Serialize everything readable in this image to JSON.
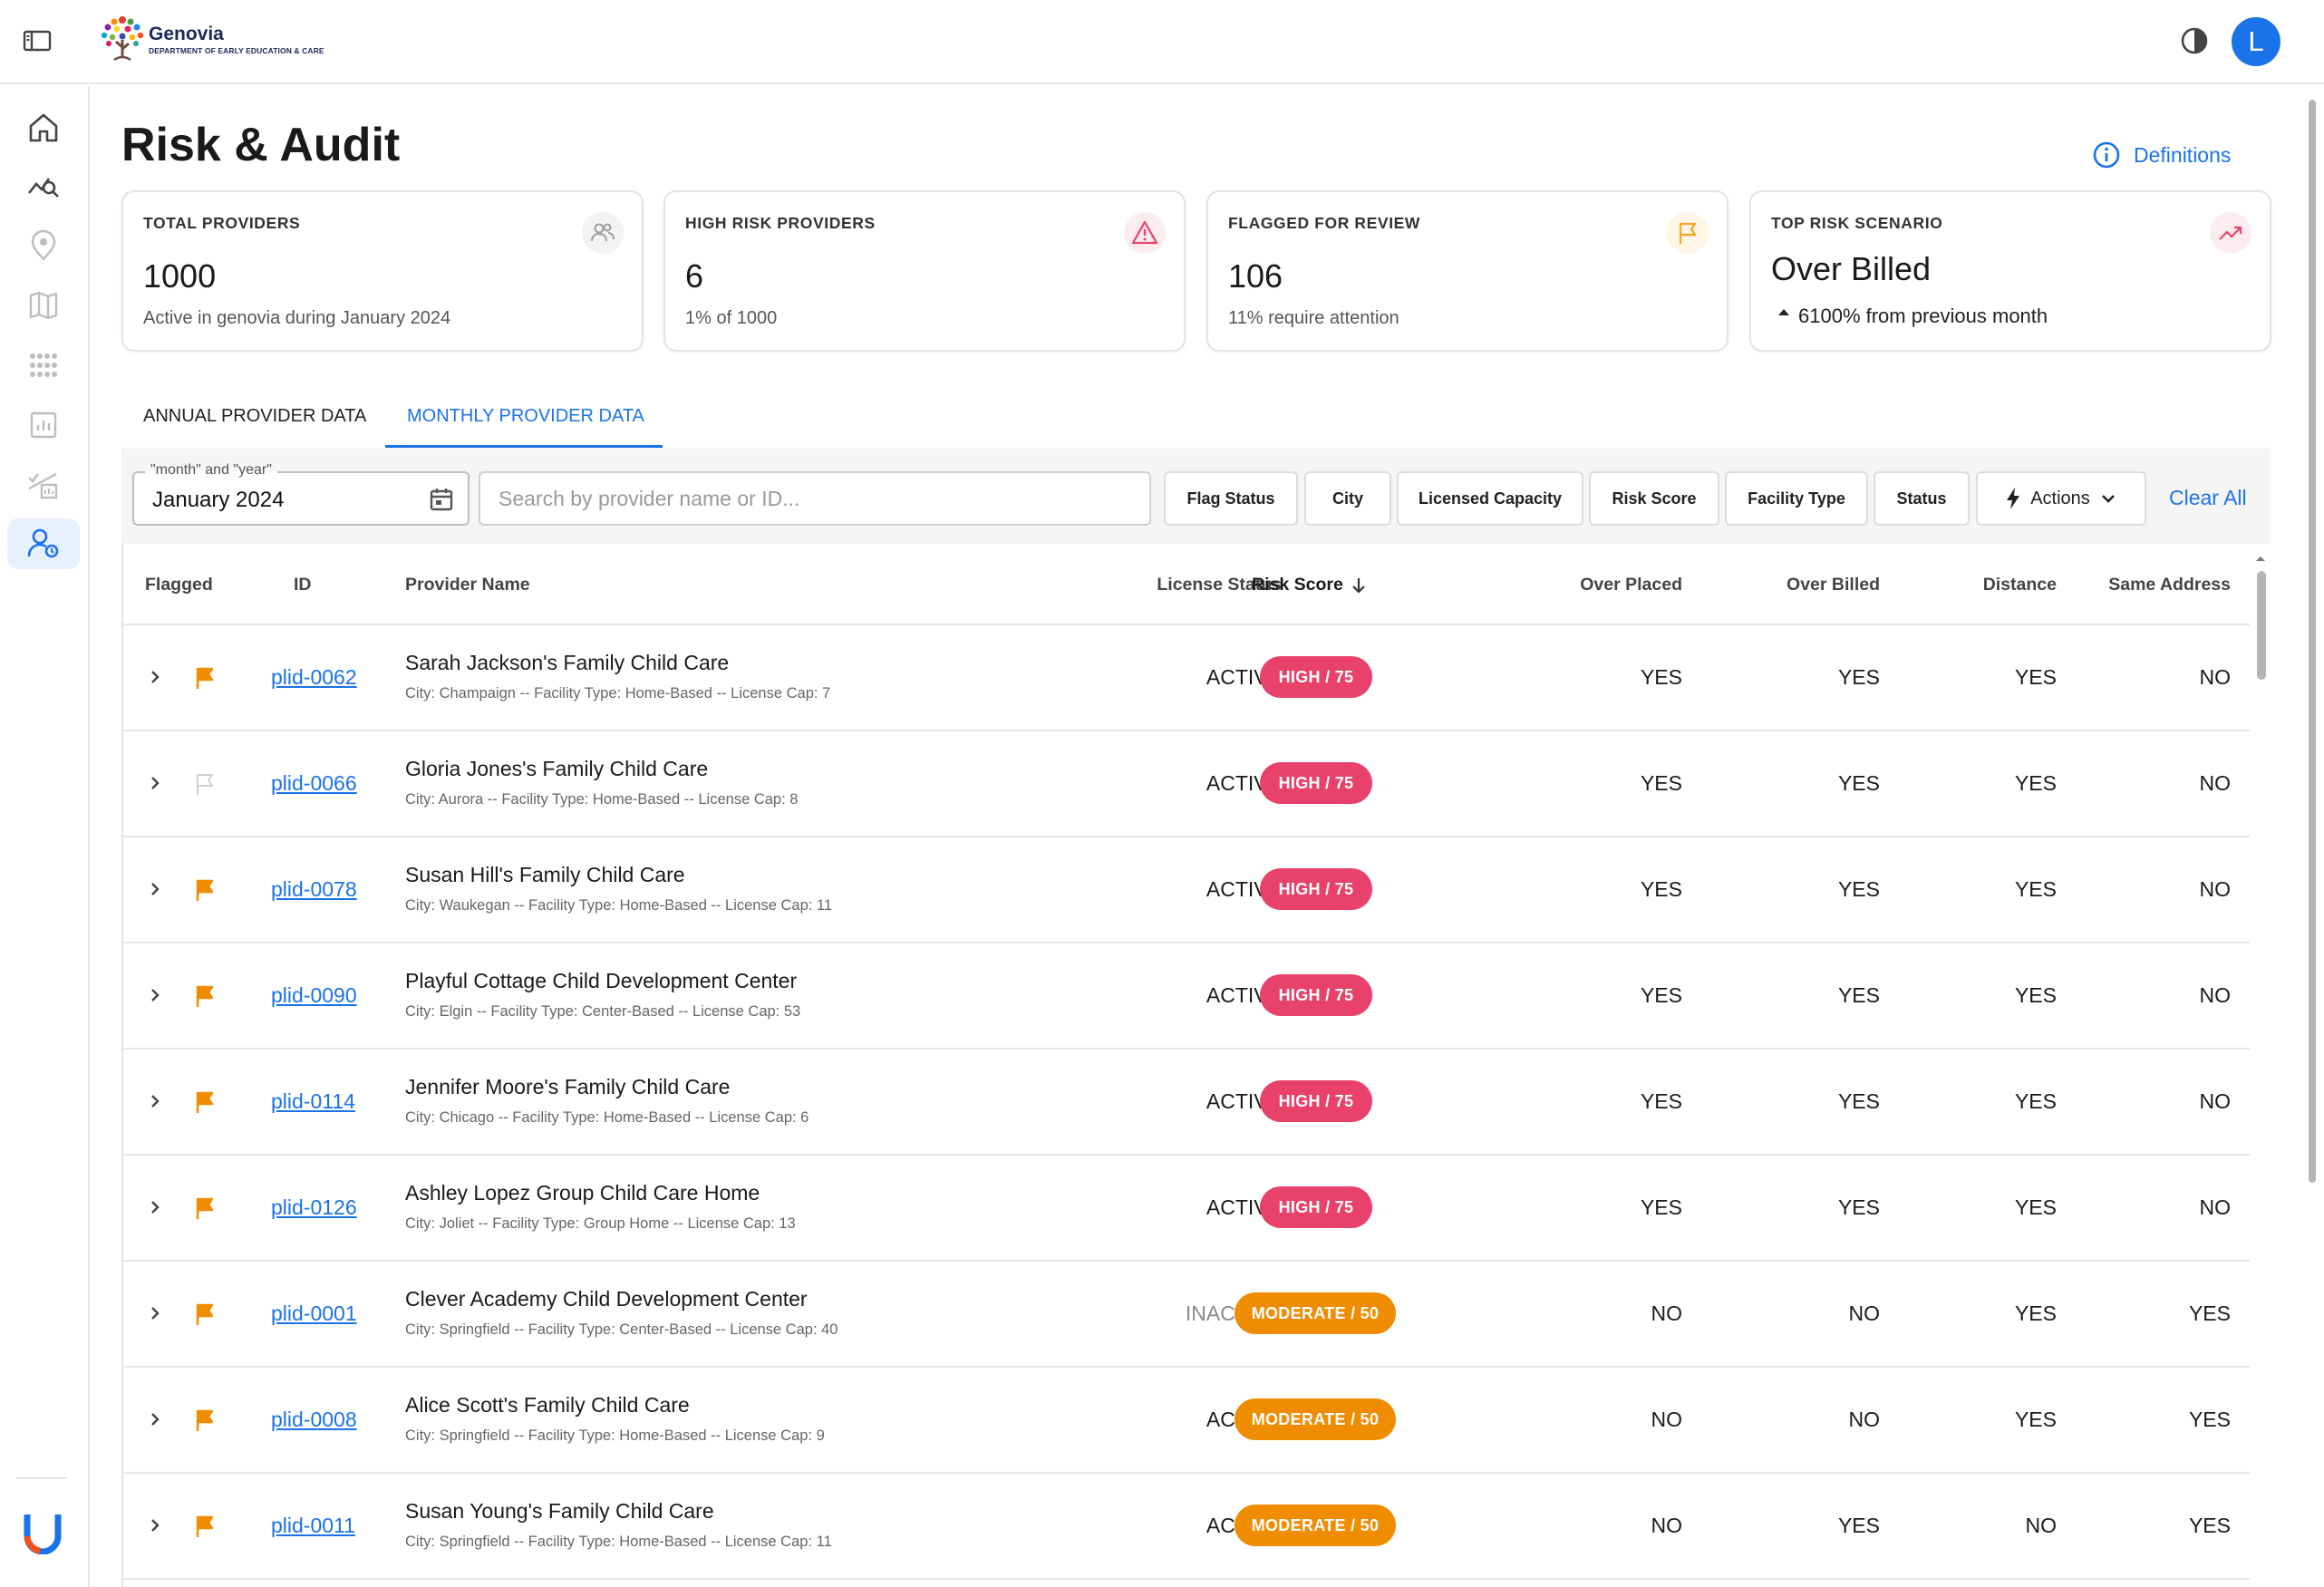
{
  "brand": {
    "name": "Genovia",
    "subtitle": "DEPARTMENT OF EARLY EDUCATION & CARE"
  },
  "user": {
    "avatar_initial": "L"
  },
  "rail": {
    "items": [
      {
        "icon": "home-icon"
      },
      {
        "icon": "analytics-search-icon"
      },
      {
        "icon": "location-pin-icon"
      },
      {
        "icon": "map-icon"
      },
      {
        "icon": "apps-grid-icon"
      },
      {
        "icon": "report-chart-icon"
      },
      {
        "icon": "checklist-chart-icon"
      },
      {
        "icon": "user-audit-icon",
        "active": true
      }
    ]
  },
  "page": {
    "title": "Risk & Audit",
    "definitions_label": "Definitions"
  },
  "cards": [
    {
      "label": "TOTAL PROVIDERS",
      "value": "1000",
      "sub": "Active in genovia during January 2024",
      "icon": "people-icon",
      "color": "#9e9e9e"
    },
    {
      "label": "HIGH RISK PROVIDERS",
      "value": "6",
      "sub": "1% of 1000",
      "icon": "warning-icon",
      "color": "#e8416a"
    },
    {
      "label": "FLAGGED FOR REVIEW",
      "value": "106",
      "sub": "11% require attention",
      "icon": "flag-outline-icon",
      "color": "#f5a623"
    },
    {
      "label": "TOP RISK SCENARIO",
      "value": "Over Billed",
      "sub": "6100% from previous month",
      "icon": "trending-up-icon",
      "color": "#e8416a"
    }
  ],
  "tabs": [
    {
      "label": "ANNUAL PROVIDER DATA",
      "active": false
    },
    {
      "label": "MONTHLY PROVIDER DATA",
      "active": true
    }
  ],
  "filters": {
    "date_label": "\"month\" and \"year\"",
    "date_value": "January 2024",
    "search_placeholder": "Search by provider name or ID...",
    "buttons": [
      "Flag Status",
      "City",
      "Licensed Capacity",
      "Risk Score",
      "Facility Type",
      "Status"
    ],
    "actions_label": "Actions",
    "clear_all": "Clear All"
  },
  "table": {
    "columns": {
      "flagged": "Flagged",
      "id": "ID",
      "provider_name": "Provider Name",
      "license_status": "License Status",
      "risk_score": "Risk Score",
      "over_placed": "Over Placed",
      "over_billed": "Over Billed",
      "distance": "Distance",
      "same_address": "Same Address"
    },
    "rows": [
      {
        "flagged": true,
        "id": "plid-0062",
        "name": "Sarah Jackson's Family Child Care",
        "meta": "City: Champaign -- Facility Type: Home-Based -- License Cap: 7",
        "license": "ACTIVE",
        "risk": "HIGH / 75",
        "risk_level": "high",
        "over_placed": "YES",
        "over_billed": "YES",
        "distance": "YES",
        "same_address": "NO"
      },
      {
        "flagged": false,
        "id": "plid-0066",
        "name": "Gloria Jones's Family Child Care",
        "meta": "City: Aurora -- Facility Type: Home-Based -- License Cap: 8",
        "license": "ACTIVE",
        "risk": "HIGH / 75",
        "risk_level": "high",
        "over_placed": "YES",
        "over_billed": "YES",
        "distance": "YES",
        "same_address": "NO"
      },
      {
        "flagged": true,
        "id": "plid-0078",
        "name": "Susan Hill's Family Child Care",
        "meta": "City: Waukegan -- Facility Type: Home-Based -- License Cap: 11",
        "license": "ACTIVE",
        "risk": "HIGH / 75",
        "risk_level": "high",
        "over_placed": "YES",
        "over_billed": "YES",
        "distance": "YES",
        "same_address": "NO"
      },
      {
        "flagged": true,
        "id": "plid-0090",
        "name": "Playful Cottage Child Development Center",
        "meta": "City: Elgin -- Facility Type: Center-Based -- License Cap: 53",
        "license": "ACTIVE",
        "risk": "HIGH / 75",
        "risk_level": "high",
        "over_placed": "YES",
        "over_billed": "YES",
        "distance": "YES",
        "same_address": "NO"
      },
      {
        "flagged": true,
        "id": "plid-0114",
        "name": "Jennifer Moore's Family Child Care",
        "meta": "City: Chicago -- Facility Type: Home-Based -- License Cap: 6",
        "license": "ACTIVE",
        "risk": "HIGH / 75",
        "risk_level": "high",
        "over_placed": "YES",
        "over_billed": "YES",
        "distance": "YES",
        "same_address": "NO"
      },
      {
        "flagged": true,
        "id": "plid-0126",
        "name": "Ashley Lopez Group Child Care Home",
        "meta": "City: Joliet -- Facility Type: Group Home -- License Cap: 13",
        "license": "ACTIVE",
        "risk": "HIGH / 75",
        "risk_level": "high",
        "over_placed": "YES",
        "over_billed": "YES",
        "distance": "YES",
        "same_address": "NO"
      },
      {
        "flagged": true,
        "id": "plid-0001",
        "name": "Clever Academy Child Development Center",
        "meta": "City: Springfield -- Facility Type: Center-Based -- License Cap: 40",
        "license": "INACTIVE",
        "risk": "MODERATE / 50",
        "risk_level": "moderate",
        "over_placed": "NO",
        "over_billed": "NO",
        "distance": "YES",
        "same_address": "YES"
      },
      {
        "flagged": true,
        "id": "plid-0008",
        "name": "Alice Scott's Family Child Care",
        "meta": "City: Springfield -- Facility Type: Home-Based -- License Cap: 9",
        "license": "ACTIVE",
        "risk": "MODERATE / 50",
        "risk_level": "moderate",
        "over_placed": "NO",
        "over_billed": "NO",
        "distance": "YES",
        "same_address": "YES"
      },
      {
        "flagged": true,
        "id": "plid-0011",
        "name": "Susan Young's Family Child Care",
        "meta": "City: Springfield -- Facility Type: Home-Based -- License Cap: 11",
        "license": "ACTIVE",
        "risk": "MODERATE / 50",
        "risk_level": "moderate",
        "over_placed": "NO",
        "over_billed": "YES",
        "distance": "NO",
        "same_address": "YES"
      }
    ]
  },
  "colors": {
    "accent": "#1a73e8",
    "high": "#e8416a",
    "moderate": "#f08c00",
    "flag_on": "#f08c00",
    "flag_off": "#cfcfcf"
  }
}
